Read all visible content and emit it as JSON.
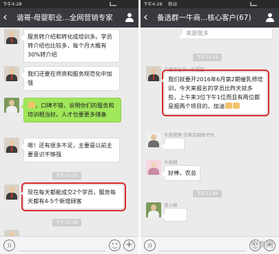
{
  "status_left": {
    "time": "下午4:28",
    "carrier": "",
    "battery": ""
  },
  "status_right": {
    "time": "下午4:28",
    "carrier": "移动",
    "battery": ""
  },
  "left": {
    "title": "谐哥-母婴职业...全网营销专家",
    "messages": [
      {
        "text": "服务转介绍和转化成培训多。学员转介绍也比较多，每个月大概有30%转介绍"
      },
      {
        "text": "我们还要在师资和服务规范化中加强"
      },
      {
        "text": "，口碑不错，说明你们的服务和培训相当好。人才也要更多储备"
      },
      {
        "text": "嗯！还有很多不足，主要是以前主要意识不够强"
      },
      {
        "text": "现在每天都能成交2个学员，服务每天都有4-5个新增顾客"
      }
    ],
    "times": [
      "下午11:31",
      "下午11:36"
    ]
  },
  "right": {
    "title": "备选群一牛商...核心客户(67)",
    "system_note": "来跟我多",
    "messages": [
      {
        "nick": "广西崇左孕一乐婴宝",
        "text": "我们就要开2016年6月第2期催乳师培训，今天来报名的学员比昨天就多些，上午来3位下午1位而且有两位都是报两个项目的，加油"
      },
      {
        "nick": "牛商观察 华商会副秘书长",
        "text": ""
      },
      {
        "nick": "牛商网",
        "text": "好棒，农总"
      },
      {
        "nick": "曾小顺",
        "text": ""
      }
    ],
    "times": [
      "下午11:01",
      "下午11:06"
    ]
  },
  "watermark": "牛商网"
}
